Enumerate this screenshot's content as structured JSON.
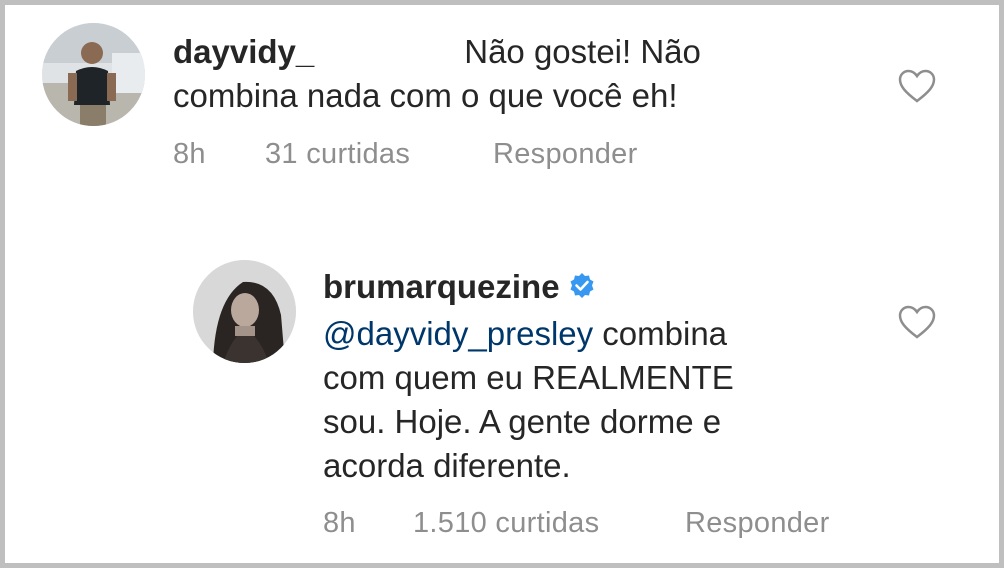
{
  "comments": [
    {
      "username": "dayvidy_",
      "text": "Não gostei! Não",
      "text_line2": "combina nada com o que você eh!",
      "time": "8h",
      "likes": "31 curtidas",
      "reply_label": "Responder",
      "avatar": "user-photo-man",
      "like_icon": "heart-outline-icon"
    },
    {
      "username": "brumarquezine",
      "verified": true,
      "mention": "@dayvidy_presley",
      "text_lines": [
        "combina",
        "com quem eu REALMENTE",
        "sou. Hoje. A gente dorme e",
        "acorda diferente."
      ],
      "time": "8h",
      "likes": "1.510 curtidas",
      "reply_label": "Responder",
      "avatar": "user-photo-woman",
      "like_icon": "heart-outline-icon",
      "verified_color": "#3897f0"
    }
  ]
}
